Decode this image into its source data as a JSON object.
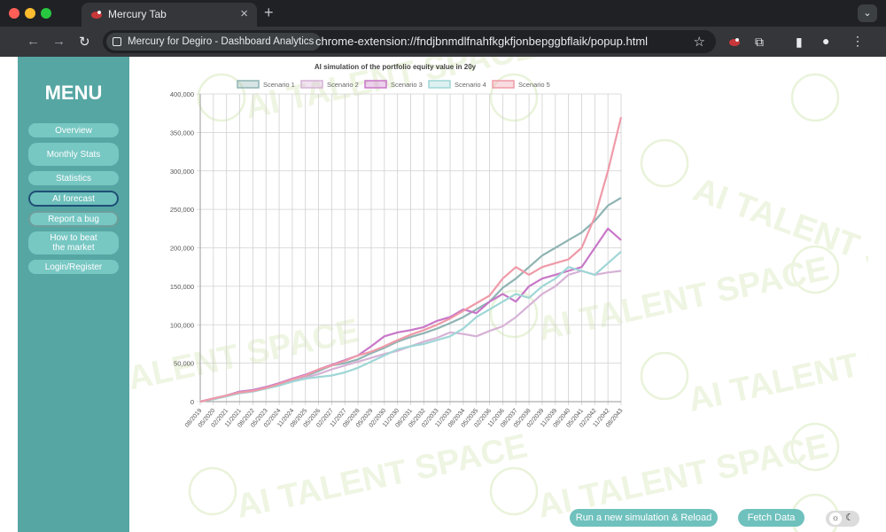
{
  "browser": {
    "tab_title": "Mercury Tab",
    "tab_close": "×",
    "new_tab": "+",
    "site_name": "Mercury for Degiro - Dashboard Analytics",
    "url": "chrome-extension://fndjbnmdlfnahfkgkfjonbepggbflaik/popup.html",
    "icons": [
      "back-icon",
      "forward-icon",
      "reload-icon",
      "star-icon",
      "extension-icon",
      "puzzle-icon",
      "sidebar-icon",
      "profile-icon",
      "more-icon"
    ]
  },
  "sidebar": {
    "title": "MENU",
    "items": [
      {
        "label": "Overview"
      },
      {
        "label": "Monthly Stats"
      },
      {
        "label": "Statistics"
      },
      {
        "label": "AI forecast"
      },
      {
        "label": "Report a bug"
      },
      {
        "label": "How to beat the market"
      },
      {
        "label": "Login/Register"
      }
    ]
  },
  "watermark": {
    "text": "AI TALENT SPACE"
  },
  "actions": {
    "run_label": "Run a new simulation & Reload",
    "fetch_label": "Fetch Data"
  },
  "theme_toggle": {
    "light": "☼",
    "dark": "☾"
  },
  "colors": {
    "sidebar": "#56a6a3",
    "button": "#77c7c3",
    "s1": "#8fb3b3",
    "s2": "#d6b2d6",
    "s3": "#c877c8",
    "s4": "#9fd6d6",
    "s5": "#ef9aa8"
  },
  "chart_data": {
    "type": "line",
    "title": "AI simulation of the portfolio equity value in 20y",
    "ylim": [
      0,
      400000
    ],
    "yticks": [
      "0",
      "50,000",
      "100,000",
      "150,000",
      "200,000",
      "250,000",
      "300,000",
      "350,000",
      "400,000"
    ],
    "categories": [
      "08/2019",
      "05/2020",
      "02/2021",
      "11/2021",
      "08/2022",
      "05/2023",
      "02/2024",
      "11/2024",
      "08/2025",
      "05/2026",
      "02/2027",
      "11/2027",
      "08/2028",
      "05/2029",
      "02/2030",
      "11/2030",
      "08/2031",
      "05/2032",
      "02/2033",
      "11/2033",
      "08/2034",
      "05/2035",
      "02/2036",
      "11/2036",
      "08/2037",
      "05/2038",
      "02/2039",
      "11/2039",
      "08/2040",
      "05/2041",
      "02/2042",
      "11/2042",
      "08/2043"
    ],
    "series": [
      {
        "name": "Scenario 1",
        "values": [
          0,
          4000,
          8000,
          13000,
          15000,
          19000,
          24000,
          29000,
          33000,
          40000,
          47000,
          50000,
          55000,
          63000,
          70000,
          78000,
          84000,
          89000,
          95000,
          102000,
          110000,
          120000,
          130000,
          148000,
          160000,
          175000,
          190000,
          200000,
          210000,
          220000,
          235000,
          255000,
          265000
        ]
      },
      {
        "name": "Scenario 2",
        "values": [
          0,
          4000,
          8000,
          12000,
          14000,
          18000,
          23000,
          27000,
          31000,
          36000,
          42000,
          47000,
          52000,
          57000,
          62000,
          66000,
          72000,
          78000,
          83000,
          90000,
          88000,
          85000,
          92000,
          98000,
          110000,
          125000,
          140000,
          150000,
          165000,
          170000,
          165000,
          168000,
          170000
        ]
      },
      {
        "name": "Scenario 3",
        "values": [
          0,
          4000,
          8000,
          13000,
          15000,
          19000,
          24000,
          30000,
          35000,
          42000,
          48000,
          54000,
          60000,
          72000,
          85000,
          90000,
          93000,
          97000,
          105000,
          110000,
          120000,
          115000,
          130000,
          140000,
          130000,
          150000,
          160000,
          165000,
          170000,
          175000,
          200000,
          225000,
          210000
        ]
      },
      {
        "name": "Scenario 4",
        "values": [
          0,
          3000,
          7000,
          11000,
          13000,
          17000,
          21000,
          26000,
          30000,
          32000,
          34000,
          38000,
          44000,
          52000,
          60000,
          68000,
          72000,
          75000,
          80000,
          85000,
          95000,
          110000,
          120000,
          130000,
          140000,
          135000,
          150000,
          160000,
          175000,
          170000,
          165000,
          180000,
          195000
        ]
      },
      {
        "name": "Scenario 5",
        "values": [
          0,
          4000,
          8000,
          12000,
          14000,
          18000,
          23000,
          29000,
          34000,
          42000,
          47000,
          53000,
          60000,
          65000,
          72000,
          80000,
          87000,
          93000,
          100000,
          108000,
          118000,
          128000,
          138000,
          160000,
          175000,
          165000,
          175000,
          180000,
          185000,
          200000,
          240000,
          300000,
          370000
        ]
      }
    ]
  }
}
